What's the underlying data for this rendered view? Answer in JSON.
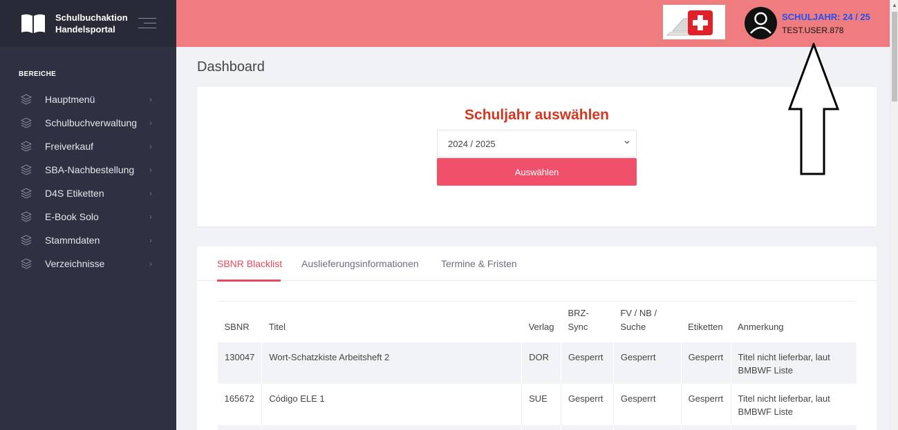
{
  "brand": {
    "line1": "Schulbuchaktion",
    "line2": "Handelsportal"
  },
  "sidebar": {
    "section_title": "BEREICHE",
    "items": [
      {
        "label": "Hauptmenü"
      },
      {
        "label": "Schulbuchverwaltung"
      },
      {
        "label": "Freiverkauf"
      },
      {
        "label": "SBA-Nachbestellung"
      },
      {
        "label": "D4S Etiketten"
      },
      {
        "label": "E-Book Solo"
      },
      {
        "label": "Stammdaten"
      },
      {
        "label": "Verzeichnisse"
      }
    ]
  },
  "header": {
    "school_year": "SCHULJAHR: 24 / 25",
    "username": "TEST.USER.878"
  },
  "main": {
    "page_title": "Dashboard",
    "year_selector": {
      "title": "Schuljahr auswählen",
      "selected_value": "2024 / 2025",
      "button_label": "Auswählen"
    },
    "tabs": [
      {
        "label": "SBNR Blacklist"
      },
      {
        "label": "Auslieferungsinformationen"
      },
      {
        "label": "Termine & Fristen"
      }
    ],
    "table": {
      "columns": [
        "SBNR",
        "Titel",
        "Verlag",
        "BRZ-\nSync",
        "FV / NB /\nSuche",
        "Etiketten",
        "Anmerkung"
      ],
      "rows": [
        [
          "130047",
          "Wort-Schatzkiste Arbeitsheft 2",
          "DOR",
          "Gesperrt",
          "Gesperrt",
          "Gesperrt",
          "Titel nicht lieferbar, laut BMBWF Liste"
        ],
        [
          "165672",
          "Código ELE 1",
          "SUE",
          "Gesperrt",
          "Gesperrt",
          "Gesperrt",
          "Titel nicht lieferbar, laut BMBWF Liste"
        ]
      ]
    }
  },
  "colors": {
    "header_bg": "#ef7d80",
    "sidebar_bg": "#2e3141",
    "accent": "#f1506b",
    "title_red": "#d4361f",
    "school_year_blue": "#2250f5"
  }
}
